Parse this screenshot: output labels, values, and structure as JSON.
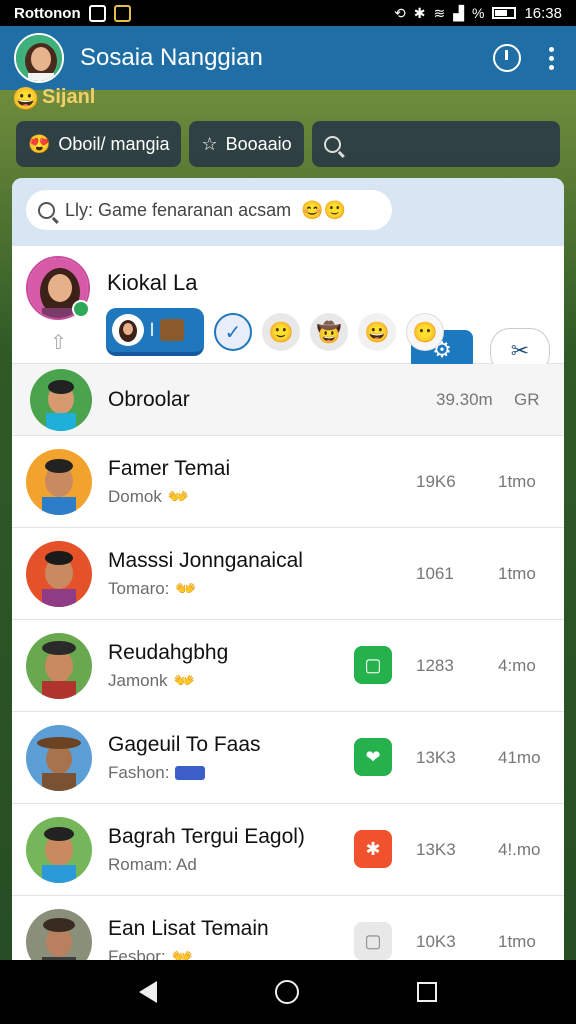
{
  "status_bar": {
    "app_label": "Rottonon",
    "time": "16:38",
    "battery_text": "%"
  },
  "app_bar": {
    "title": "Sosaia Nanggian"
  },
  "background": {
    "emoji": "😀",
    "label": "Sijanl"
  },
  "chips": [
    {
      "emoji": "😍",
      "label": "Oboil/ mangia"
    },
    {
      "emoji": "☆",
      "label": "Booaaio"
    },
    {
      "emoji": "",
      "label": ""
    }
  ],
  "search": {
    "value": "Lly: Game fenaranan acsam",
    "emoji": "😊🙂"
  },
  "profile": {
    "name": "Kiokal La",
    "avatar_color": "#c94c9c",
    "tab_marker": "l",
    "tab_emojis": [
      "🙂",
      "🤠",
      "😀",
      "😶"
    ]
  },
  "rows": [
    {
      "name": "Obroolar",
      "sub": "",
      "sub_emoji": "",
      "count": "39.30m",
      "time": "GR",
      "badge": "none"
    },
    {
      "name": "Famer Temai",
      "sub": "Domok",
      "sub_emoji": "👐",
      "count": "19K6",
      "time": "1tmo",
      "badge": "none"
    },
    {
      "name": "Masssi Jonnganaical",
      "sub": "Tomaro:",
      "sub_emoji": "👐",
      "count": "1061",
      "time": "1tmo",
      "badge": "none"
    },
    {
      "name": "Reudahgbhg",
      "sub": "Jamonk",
      "sub_emoji": "👐",
      "count": "1283",
      "time": "4:mo",
      "badge": "green-square",
      "badge_color": "#25b14b"
    },
    {
      "name": "Gageuil To Faas",
      "sub": "Fashon:",
      "sub_emoji": "",
      "count": "13K3",
      "time": "41mo",
      "badge": "green-bubble",
      "badge_color": "#25b14b"
    },
    {
      "name": "Bagrah Tergui Eagol)",
      "sub": "Romam: Ad",
      "sub_emoji": "",
      "count": "13K3",
      "time": "4!.mo",
      "badge": "orange-star",
      "badge_color": "#f0522d"
    },
    {
      "name": "Ean Lisat Temain",
      "sub": "Fesbor:",
      "sub_emoji": "👐",
      "count": "10K3",
      "time": "1tmo",
      "badge": "grey-square",
      "badge_color": "#e8e8e8"
    }
  ],
  "colors": {
    "accent": "#1f6fa6",
    "button_blue": "#1c79c0",
    "sheet_band": "#d8e6f3"
  }
}
